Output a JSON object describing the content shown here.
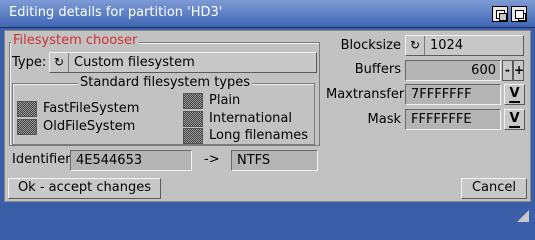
{
  "window": {
    "title": "Editing details for partition 'HD3'"
  },
  "titlebar_icons": [
    "depth-icon",
    "zoom-icon"
  ],
  "fs_chooser": {
    "legend": "Filesystem chooser",
    "type_label": "Type:",
    "type_value": "Custom filesystem",
    "std_types": {
      "legend": "Standard filesystem types",
      "items": [
        "FastFileSystem",
        "OldFileSystem",
        "Plain",
        "International",
        "Long filenames"
      ]
    },
    "identifier_label": "Identifier",
    "identifier_value": "4E544653",
    "arrow": "->",
    "identifier_name": "NTFS"
  },
  "settings": {
    "blocksize_label": "Blocksize",
    "blocksize_value": "1024",
    "buffers_label": "Buffers",
    "buffers_value": "600",
    "maxtransfer_label": "Maxtransfer",
    "maxtransfer_value": "7FFFFFFF",
    "mask_label": "Mask",
    "mask_value": "FFFFFFFE"
  },
  "buttons": {
    "ok": "Ok - accept changes",
    "cancel": "Cancel"
  },
  "colors": {
    "accent_red": "#d03030",
    "window_blue": "#3a5fa8",
    "panel_gray": "#c2c2c2"
  }
}
